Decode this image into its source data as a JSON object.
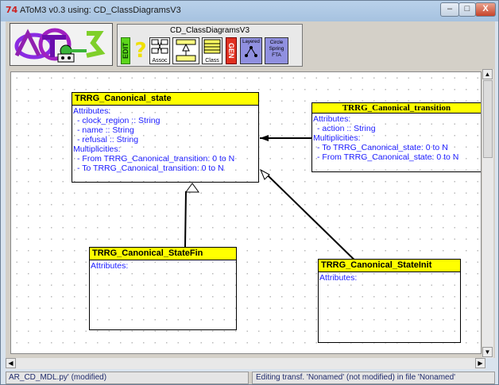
{
  "window": {
    "title": "AToM3 v0.3 using: CD_ClassDiagramsV3",
    "app_icon": "74",
    "minimize": "–",
    "maximize": "□",
    "close": "X"
  },
  "toolbar": {
    "panel_title": "CD_ClassDiagramsV3",
    "edit_label": "EDIT",
    "help_label": "?",
    "assoc_label": "Assoc",
    "inherit_label": "",
    "class_label": "Class",
    "gen_label": "GEN",
    "layered_label": "Layered",
    "circle_label": "Circle Spring FTA",
    "logo_text": "AToM3"
  },
  "classes": [
    {
      "name": "TRRG_Canonical_state",
      "lines": [
        "Attributes:",
        "- clock_region :: String",
        "- name :: String",
        "- refusal :: String",
        "Multiplicities:",
        "- From TRRG_Canonical_transition: 0 to N",
        "- To TRRG_Canonical_transition: 0 to N"
      ]
    },
    {
      "name": "TRRG_Canonical_transition",
      "lines": [
        "Attributes:",
        "- action :: String",
        "Multiplicities:",
        "- To TRRG_Canonical_state: 0 to N",
        "- From TRRG_Canonical_state: 0 to N"
      ]
    },
    {
      "name": "TRRG_Canonical_StateFin",
      "lines": [
        "Attributes:"
      ]
    },
    {
      "name": "TRRG_Canonical_StateInit",
      "lines": [
        "Attributes:"
      ]
    }
  ],
  "status": {
    "left": "AR_CD_MDL.py' (modified)",
    "right": "Editing transf. 'Nonamed' (not modified) in file 'Nonamed'"
  },
  "colors": {
    "class_header": "#ffff00",
    "attribute_text": "#1a1aff"
  }
}
